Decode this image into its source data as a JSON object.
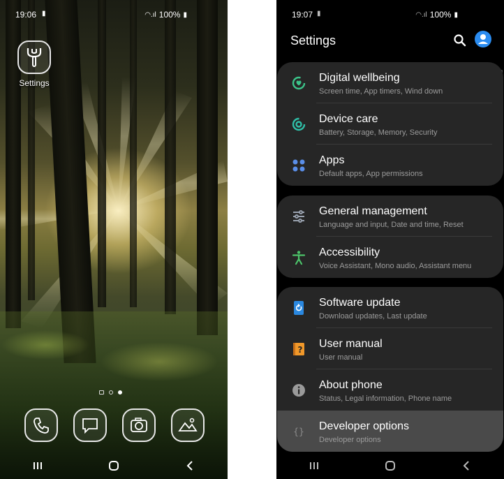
{
  "home": {
    "status": {
      "time": "19:06",
      "battery": "100%"
    },
    "app": {
      "label": "Settings"
    },
    "dock": [
      "phone-icon",
      "messages-icon",
      "camera-icon",
      "gallery-icon"
    ]
  },
  "settings": {
    "status": {
      "time": "19:07",
      "battery": "100%"
    },
    "title": "Settings",
    "groups": [
      [
        {
          "title": "Digital wellbeing",
          "subtitle": "Screen time, App timers, Wind down",
          "icon": "digital-wellbeing-icon",
          "color": "#3cc48a"
        },
        {
          "title": "Device care",
          "subtitle": "Battery, Storage, Memory, Security",
          "icon": "device-care-icon",
          "color": "#2fbfa8"
        },
        {
          "title": "Apps",
          "subtitle": "Default apps, App permissions",
          "icon": "apps-icon",
          "color": "#5a8ee8"
        }
      ],
      [
        {
          "title": "General management",
          "subtitle": "Language and input, Date and time, Reset",
          "icon": "sliders-icon",
          "color": "#9aa3b0"
        },
        {
          "title": "Accessibility",
          "subtitle": "Voice Assistant, Mono audio, Assistant menu",
          "icon": "accessibility-icon",
          "color": "#4cc46a"
        }
      ],
      [
        {
          "title": "Software update",
          "subtitle": "Download updates, Last update",
          "icon": "software-update-icon",
          "color": "#2a88e0"
        },
        {
          "title": "User manual",
          "subtitle": "User manual",
          "icon": "user-manual-icon",
          "color": "#f0982a"
        },
        {
          "title": "About phone",
          "subtitle": "Status, Legal information, Phone name",
          "icon": "info-icon",
          "color": "#9a9a9a"
        },
        {
          "title": "Developer options",
          "subtitle": "Developer options",
          "icon": "braces-icon",
          "color": "#8a8a8a"
        }
      ]
    ]
  }
}
